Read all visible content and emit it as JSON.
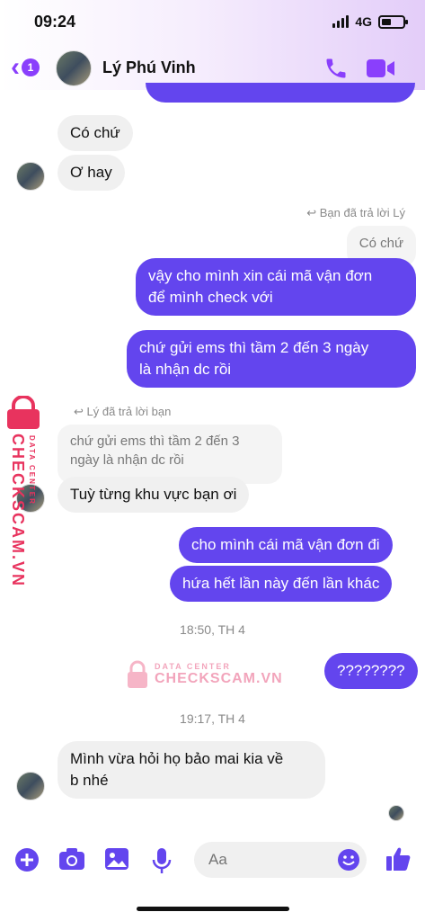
{
  "status_bar": {
    "time": "09:24",
    "network": "4G"
  },
  "header": {
    "back_badge": "1",
    "contact_name": "Lý Phú Vinh"
  },
  "messages": {
    "in_1": "Có chứ",
    "in_2": "Ơ hay",
    "reply_note_1": "Bạn đã trả lời Lý",
    "quote_1": "Có chứ",
    "out_1_line1": "vậy cho mình xin cái mã vận đơn",
    "out_1_line2": "để mình check với",
    "out_2_line1": "chứ gửi ems thì tầm 2 đến 3 ngày",
    "out_2_line2": "là nhận dc rồi",
    "reply_note_2": "Lý đã trả lời bạn",
    "quote_2_line1": "chứ gửi ems thì tầm 2 đến 3",
    "quote_2_line2": "ngày là nhận dc rồi",
    "in_3": "Tuỳ từng khu vực bạn ơi",
    "out_3": "cho mình cái mã vận đơn đi",
    "out_4": "hứa hết lần này đến lần khác",
    "time_1": "18:50, TH 4",
    "out_5": "????????",
    "time_2": "19:17, TH 4",
    "in_4_line1": "Mình vừa hỏi họ bảo mai kia về",
    "in_4_line2": "b nhé"
  },
  "watermark": {
    "small": "DATA CENTER",
    "big": "CHECKSCAM.VN",
    "side_big": "CHECKSCAM.VN",
    "side_small": "DATA CENTER"
  },
  "composer": {
    "placeholder": "Aa"
  },
  "colors": {
    "accent": "#8a3ffc",
    "outgoing": "#6345ee",
    "incoming": "#f0f0f0",
    "watermark": "#e8335e"
  }
}
